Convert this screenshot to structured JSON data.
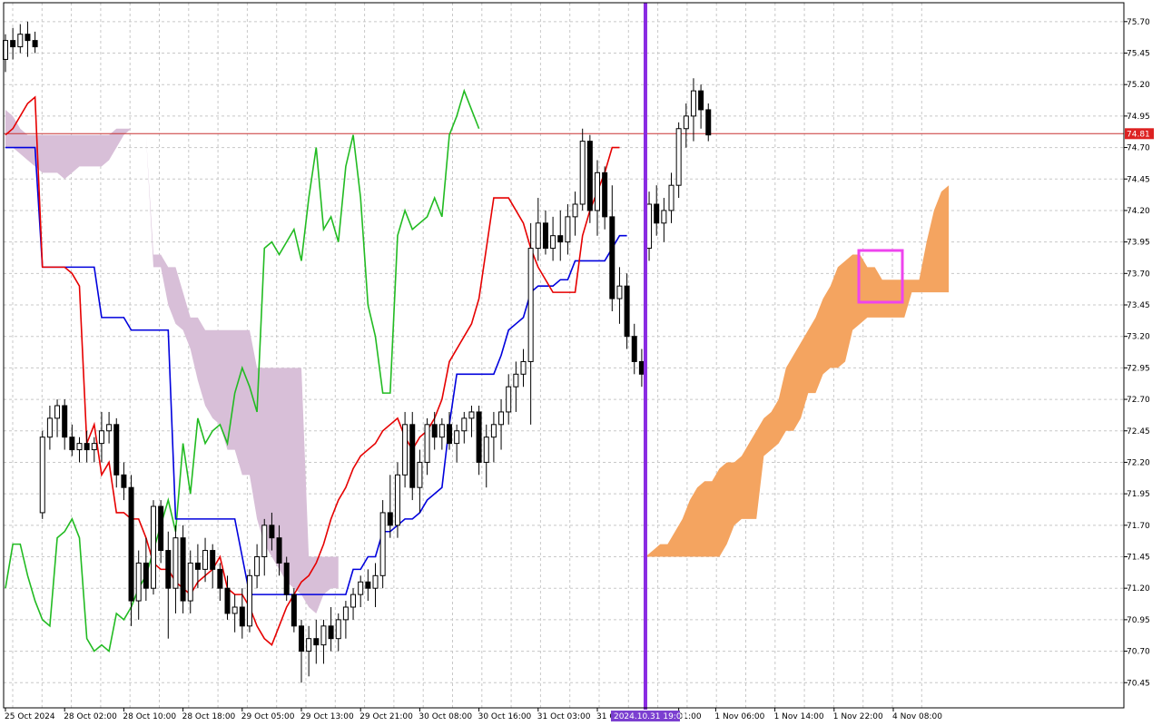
{
  "chart_data": {
    "type": "candlestick",
    "y_ticks": [
      "75.70",
      "75.45",
      "75.20",
      "74.95",
      "74.70",
      "74.45",
      "74.20",
      "73.95",
      "73.70",
      "73.45",
      "73.20",
      "72.95",
      "72.70",
      "72.45",
      "72.20",
      "71.95",
      "71.70",
      "71.45",
      "71.20",
      "70.95",
      "70.70",
      "70.45"
    ],
    "y_tick_values": [
      75.7,
      75.45,
      75.2,
      74.95,
      74.7,
      74.45,
      74.2,
      73.95,
      73.7,
      73.45,
      73.2,
      72.95,
      72.7,
      72.45,
      72.2,
      71.95,
      71.7,
      71.45,
      71.2,
      70.95,
      70.7,
      70.45
    ],
    "ylim": [
      70.25,
      75.85
    ],
    "x_ticks": [
      "25 Oct 2024",
      "28 Oct 02:00",
      "28 Oct 10:00",
      "28 Oct 18:00",
      "29 Oct 05:00",
      "29 Oct 13:00",
      "29 Oct 21:00",
      "30 Oct 08:00",
      "30 Oct 16:00",
      "31 Oct 03:00",
      "31 Oc",
      "01:00",
      "1 Nov 06:00",
      "1 Nov 14:00",
      "1 Nov 22:00",
      "4 Nov 08:00"
    ],
    "x_tick_index": [
      0,
      8,
      16,
      24,
      32,
      40,
      48,
      56,
      64,
      72,
      80,
      91,
      96,
      104,
      112,
      120
    ],
    "current_price": "74.81",
    "current_price_value": 74.81,
    "cursor_time": "2024.10.31 19:00",
    "cursor_index": 86.5,
    "grid": true,
    "colors": {
      "candle_up_body": "#ffffff",
      "candle_down_body": "#000000",
      "tenkan": "#e60000",
      "kijun": "#0000dd",
      "chikou": "#22bb22",
      "kumo_bull": "#f4a460",
      "kumo_bear": "#d8bfd8",
      "price_line": "#c83232",
      "cursor_line": "#8a2be2",
      "highlight_box": "#ee44ee"
    },
    "candles": [
      [
        75.4,
        75.6,
        75.3,
        75.55
      ],
      [
        75.55,
        75.65,
        75.4,
        75.5
      ],
      [
        75.5,
        75.68,
        75.45,
        75.6
      ],
      [
        75.6,
        75.7,
        75.42,
        75.55
      ],
      [
        75.55,
        75.62,
        75.45,
        75.5
      ],
      [
        71.8,
        72.45,
        71.75,
        72.4
      ],
      [
        72.4,
        72.65,
        72.3,
        72.55
      ],
      [
        72.55,
        72.7,
        72.4,
        72.65
      ],
      [
        72.65,
        72.7,
        72.3,
        72.4
      ],
      [
        72.4,
        72.5,
        72.25,
        72.3
      ],
      [
        72.3,
        72.4,
        72.2,
        72.35
      ],
      [
        72.35,
        72.45,
        72.2,
        72.3
      ],
      [
        72.3,
        72.4,
        72.2,
        72.35
      ],
      [
        72.35,
        72.6,
        72.2,
        72.45
      ],
      [
        72.45,
        72.6,
        72.35,
        72.5
      ],
      [
        72.5,
        72.55,
        72.0,
        72.1
      ],
      [
        72.1,
        72.2,
        71.9,
        72.0
      ],
      [
        72.0,
        72.1,
        70.9,
        71.1
      ],
      [
        71.1,
        71.5,
        70.95,
        71.4
      ],
      [
        71.4,
        71.6,
        71.1,
        71.2
      ],
      [
        71.2,
        71.9,
        71.15,
        71.85
      ],
      [
        71.85,
        71.9,
        71.4,
        71.5
      ],
      [
        71.5,
        71.65,
        70.8,
        71.2
      ],
      [
        71.2,
        71.7,
        71.0,
        71.6
      ],
      [
        71.6,
        71.7,
        71.0,
        71.1
      ],
      [
        71.1,
        71.5,
        71.0,
        71.4
      ],
      [
        71.4,
        71.55,
        71.2,
        71.35
      ],
      [
        71.35,
        71.6,
        71.25,
        71.5
      ],
      [
        71.5,
        71.55,
        71.2,
        71.35
      ],
      [
        71.35,
        71.4,
        71.1,
        71.2
      ],
      [
        71.2,
        71.3,
        70.95,
        71.0
      ],
      [
        71.0,
        71.15,
        70.85,
        71.05
      ],
      [
        71.05,
        71.2,
        70.8,
        70.9
      ],
      [
        70.9,
        71.35,
        70.85,
        71.3
      ],
      [
        71.3,
        71.55,
        71.2,
        71.45
      ],
      [
        71.45,
        71.75,
        71.3,
        71.7
      ],
      [
        71.7,
        71.8,
        71.5,
        71.6
      ],
      [
        71.6,
        71.7,
        71.3,
        71.4
      ],
      [
        71.4,
        71.45,
        71.1,
        71.15
      ],
      [
        71.15,
        71.2,
        70.85,
        70.9
      ],
      [
        70.9,
        70.95,
        70.45,
        70.7
      ],
      [
        70.7,
        70.9,
        70.5,
        70.8
      ],
      [
        70.8,
        70.95,
        70.6,
        70.75
      ],
      [
        70.75,
        70.95,
        70.6,
        70.9
      ],
      [
        70.9,
        71.05,
        70.7,
        70.8
      ],
      [
        70.8,
        71.0,
        70.7,
        70.95
      ],
      [
        70.95,
        71.1,
        70.8,
        71.05
      ],
      [
        71.05,
        71.2,
        70.95,
        71.15
      ],
      [
        71.15,
        71.3,
        71.05,
        71.25
      ],
      [
        71.25,
        71.35,
        71.1,
        71.2
      ],
      [
        71.2,
        71.4,
        71.05,
        71.3
      ],
      [
        71.3,
        71.9,
        71.2,
        71.8
      ],
      [
        71.8,
        72.1,
        71.6,
        71.7
      ],
      [
        71.7,
        72.2,
        71.6,
        72.1
      ],
      [
        72.1,
        72.6,
        72.0,
        72.5
      ],
      [
        72.5,
        72.6,
        71.9,
        72.0
      ],
      [
        72.0,
        72.3,
        71.8,
        72.2
      ],
      [
        72.2,
        72.55,
        72.1,
        72.5
      ],
      [
        72.5,
        72.6,
        72.3,
        72.4
      ],
      [
        72.4,
        72.55,
        72.3,
        72.5
      ],
      [
        72.5,
        72.6,
        72.3,
        72.35
      ],
      [
        72.35,
        72.5,
        72.2,
        72.45
      ],
      [
        72.45,
        72.6,
        72.35,
        72.55
      ],
      [
        72.55,
        72.65,
        72.4,
        72.6
      ],
      [
        72.6,
        72.65,
        72.1,
        72.2
      ],
      [
        72.2,
        72.5,
        72.0,
        72.4
      ],
      [
        72.4,
        72.6,
        72.2,
        72.5
      ],
      [
        72.5,
        72.7,
        72.3,
        72.6
      ],
      [
        72.6,
        72.9,
        72.5,
        72.8
      ],
      [
        72.8,
        73.0,
        72.6,
        72.9
      ],
      [
        72.9,
        73.1,
        72.8,
        73.0
      ],
      [
        73.0,
        74.1,
        72.5,
        73.9
      ],
      [
        73.9,
        74.3,
        73.8,
        74.1
      ],
      [
        74.1,
        74.2,
        73.85,
        73.9
      ],
      [
        73.9,
        74.15,
        73.8,
        74.0
      ],
      [
        74.0,
        74.2,
        73.8,
        73.95
      ],
      [
        73.95,
        74.25,
        73.85,
        74.15
      ],
      [
        74.15,
        74.35,
        74.0,
        74.25
      ],
      [
        74.25,
        74.85,
        74.2,
        74.75
      ],
      [
        74.75,
        74.8,
        74.1,
        74.2
      ],
      [
        74.2,
        74.6,
        74.0,
        74.5
      ],
      [
        74.5,
        74.55,
        74.05,
        74.15
      ],
      [
        74.15,
        74.4,
        73.4,
        73.5
      ],
      [
        73.5,
        73.75,
        73.3,
        73.6
      ],
      [
        73.6,
        73.7,
        73.1,
        73.2
      ],
      [
        73.2,
        73.3,
        72.9,
        73.0
      ],
      [
        73.0,
        73.1,
        72.8,
        72.9
      ],
      [
        73.9,
        74.35,
        73.8,
        74.25
      ],
      [
        74.25,
        74.4,
        74.0,
        74.1
      ],
      [
        74.1,
        74.3,
        73.95,
        74.2
      ],
      [
        74.2,
        74.5,
        74.1,
        74.4
      ],
      [
        74.4,
        74.9,
        74.3,
        74.85
      ],
      [
        74.85,
        75.05,
        74.7,
        74.95
      ],
      [
        74.95,
        75.25,
        74.75,
        75.15
      ],
      [
        75.15,
        75.2,
        74.85,
        75.0
      ],
      [
        75.0,
        75.05,
        74.75,
        74.8
      ]
    ],
    "tenkan": [
      74.8,
      74.85,
      74.95,
      75.05,
      75.1,
      73.75,
      73.75,
      73.75,
      73.75,
      73.7,
      73.6,
      72.35,
      72.5,
      72.1,
      72.2,
      71.8,
      71.8,
      71.75,
      71.75,
      71.6,
      71.4,
      71.35,
      71.35,
      71.25,
      71.2,
      71.15,
      71.25,
      71.3,
      71.35,
      71.45,
      71.2,
      71.15,
      71.15,
      71.05,
      70.9,
      70.8,
      70.75,
      70.9,
      71.05,
      71.15,
      71.25,
      71.3,
      71.4,
      71.55,
      71.75,
      71.9,
      72.0,
      72.15,
      72.25,
      72.3,
      72.35,
      72.45,
      72.5,
      72.55,
      72.4,
      72.3,
      72.4,
      72.45,
      72.55,
      72.7,
      73.0,
      73.1,
      73.2,
      73.3,
      73.5,
      73.9,
      74.3,
      74.3,
      74.3,
      74.2,
      74.1,
      73.9,
      73.75,
      73.65,
      73.55,
      73.55,
      73.55,
      73.55,
      74.0,
      74.2,
      74.35,
      74.5,
      74.7,
      74.7
    ],
    "kijun": [
      74.7,
      74.7,
      74.7,
      74.7,
      74.7,
      73.75,
      73.75,
      73.75,
      73.75,
      73.75,
      73.75,
      73.75,
      73.75,
      73.35,
      73.35,
      73.35,
      73.35,
      73.25,
      73.25,
      73.25,
      73.25,
      73.25,
      73.25,
      71.75,
      71.75,
      71.75,
      71.75,
      71.75,
      71.75,
      71.75,
      71.75,
      71.75,
      71.45,
      71.15,
      71.15,
      71.15,
      71.15,
      71.15,
      71.15,
      71.15,
      71.15,
      71.15,
      71.15,
      71.15,
      71.15,
      71.15,
      71.15,
      71.35,
      71.35,
      71.45,
      71.45,
      71.65,
      71.65,
      71.7,
      71.75,
      71.75,
      71.8,
      71.9,
      71.95,
      72.0,
      72.5,
      72.9,
      72.9,
      72.9,
      72.9,
      72.9,
      72.9,
      73.05,
      73.25,
      73.3,
      73.35,
      73.55,
      73.6,
      73.6,
      73.6,
      73.65,
      73.65,
      73.8,
      73.8,
      73.8,
      73.8,
      73.8,
      73.9,
      74.0,
      74.0
    ],
    "chikou": [
      71.2,
      71.55,
      71.55,
      71.3,
      71.1,
      70.95,
      70.9,
      71.6,
      71.65,
      71.75,
      71.6,
      70.8,
      70.7,
      70.75,
      70.7,
      71.0,
      70.95,
      71.05,
      71.2,
      71.3,
      71.5,
      71.7,
      71.9,
      71.65,
      72.35,
      71.95,
      72.55,
      72.35,
      72.45,
      72.5,
      72.35,
      72.75,
      72.95,
      72.8,
      72.6,
      73.9,
      73.95,
      73.85,
      73.95,
      74.05,
      73.8,
      74.3,
      74.7,
      74.05,
      74.15,
      73.95,
      74.55,
      74.8,
      74.3,
      73.45,
      73.2,
      72.75,
      72.75,
      74.0,
      74.2,
      74.05,
      74.1,
      74.15,
      74.3,
      74.15,
      74.8,
      74.95,
      75.15,
      75.0,
      74.85
    ],
    "kumo_past_a": [
      75.0,
      74.95,
      74.85,
      74.8,
      74.8,
      74.8,
      74.8,
      74.8,
      74.8,
      74.8,
      74.8,
      74.8,
      74.8,
      74.8,
      74.8,
      74.85,
      74.85,
      74.85,
      74.85,
      74.8,
      73.85,
      73.85,
      73.75,
      73.75,
      73.55,
      73.35,
      73.35,
      73.25,
      73.25,
      73.25,
      73.25,
      73.25,
      73.25,
      73.25,
      72.95,
      72.95,
      72.95,
      72.95,
      72.95,
      72.95,
      72.95,
      71.45,
      71.45,
      71.45,
      71.45,
      71.45
    ],
    "kumo_past_b": [
      74.7,
      74.7,
      74.65,
      74.6,
      74.55,
      74.5,
      74.5,
      74.5,
      74.45,
      74.5,
      74.55,
      74.55,
      74.55,
      74.55,
      74.6,
      74.7,
      74.8,
      74.85,
      74.85,
      74.8,
      73.75,
      73.75,
      73.45,
      73.3,
      73.25,
      73.1,
      72.85,
      72.65,
      72.55,
      72.5,
      72.3,
      72.3,
      72.1,
      72.1,
      71.75,
      71.55,
      71.45,
      71.35,
      71.25,
      71.2,
      71.15,
      71.05,
      71.0,
      71.15,
      71.2,
      71.2
    ],
    "kumo_future_a": [
      71.45,
      71.5,
      71.55,
      71.55,
      71.65,
      71.75,
      71.9,
      72.0,
      72.05,
      72.05,
      72.15,
      72.2,
      72.2,
      72.25,
      72.35,
      72.45,
      72.55,
      72.6,
      72.7,
      72.95,
      73.05,
      73.15,
      73.25,
      73.35,
      73.5,
      73.6,
      73.75,
      73.8,
      73.85,
      73.85,
      73.75,
      73.75,
      73.65,
      73.65,
      73.65,
      73.65,
      73.65,
      73.65,
      73.95,
      74.2,
      74.35,
      74.4
    ],
    "kumo_future_b": [
      71.45,
      71.45,
      71.45,
      71.45,
      71.45,
      71.45,
      71.45,
      71.45,
      71.45,
      71.45,
      71.45,
      71.55,
      71.7,
      71.75,
      71.75,
      71.75,
      72.25,
      72.3,
      72.35,
      72.45,
      72.45,
      72.55,
      72.75,
      72.75,
      72.9,
      72.95,
      72.95,
      73.0,
      73.25,
      73.3,
      73.35,
      73.35,
      73.35,
      73.35,
      73.35,
      73.35,
      73.55,
      73.55,
      73.55,
      73.55,
      73.55,
      73.55
    ]
  }
}
